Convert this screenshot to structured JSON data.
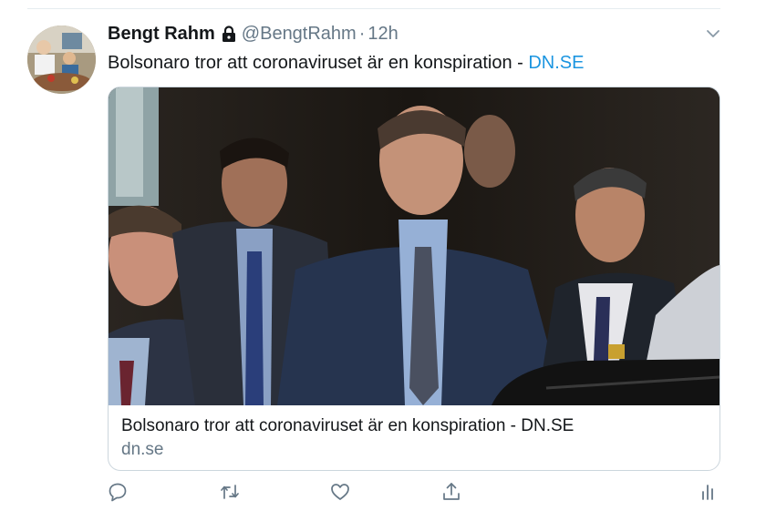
{
  "tweet": {
    "author_name": "Bengt Rahm",
    "handle": "@BengtRahm",
    "separator": "·",
    "time": "12h",
    "text": "Bolsonaro tror att coronaviruset är en konspiration - ",
    "text_link": "DN.SE"
  },
  "card": {
    "title": "Bolsonaro tror att coronaviruset är en konspiration - DN.SE",
    "domain": "dn.se"
  },
  "actions": [
    "reply-icon",
    "retweet-icon",
    "like-icon",
    "share-icon",
    "analytics-icon"
  ],
  "colors": {
    "link": "#1b95e0",
    "muted": "#657786",
    "border": "#ccd6dd",
    "text": "#14171a"
  }
}
